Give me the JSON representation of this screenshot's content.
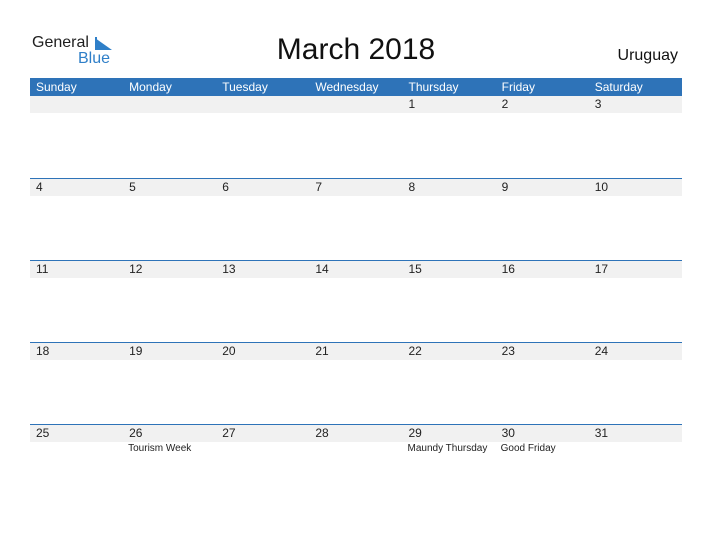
{
  "logo": {
    "general": "General",
    "blue": "Blue"
  },
  "title": "March 2018",
  "country": "Uruguay",
  "weekdays": [
    "Sunday",
    "Monday",
    "Tuesday",
    "Wednesday",
    "Thursday",
    "Friday",
    "Saturday"
  ],
  "weeks": [
    {
      "days": [
        "",
        "",
        "",
        "",
        "1",
        "2",
        "3"
      ],
      "events": [
        "",
        "",
        "",
        "",
        "",
        "",
        ""
      ]
    },
    {
      "days": [
        "4",
        "5",
        "6",
        "7",
        "8",
        "9",
        "10"
      ],
      "events": [
        "",
        "",
        "",
        "",
        "",
        "",
        ""
      ]
    },
    {
      "days": [
        "11",
        "12",
        "13",
        "14",
        "15",
        "16",
        "17"
      ],
      "events": [
        "",
        "",
        "",
        "",
        "",
        "",
        ""
      ]
    },
    {
      "days": [
        "18",
        "19",
        "20",
        "21",
        "22",
        "23",
        "24"
      ],
      "events": [
        "",
        "",
        "",
        "",
        "",
        "",
        ""
      ]
    },
    {
      "days": [
        "25",
        "26",
        "27",
        "28",
        "29",
        "30",
        "31"
      ],
      "events": [
        "",
        "Tourism Week",
        "",
        "",
        "Maundy Thursday",
        "Good Friday",
        ""
      ]
    }
  ],
  "colors": {
    "accent": "#2e73b8",
    "strip": "#f1f1f1",
    "logo_blue": "#2f7fc8"
  }
}
